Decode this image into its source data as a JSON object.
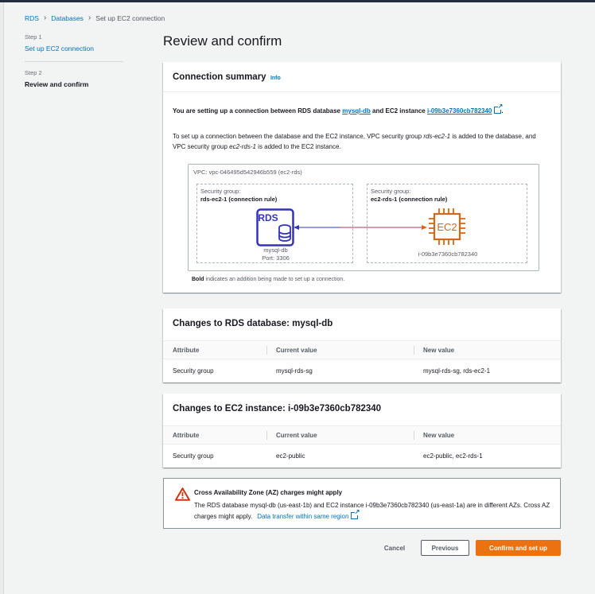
{
  "breadcrumb": {
    "items": [
      "RDS",
      "Databases"
    ],
    "current": "Set up EC2 connection"
  },
  "steps": [
    {
      "label": "Step 1",
      "title": "Set up EC2 connection"
    },
    {
      "label": "Step 2",
      "title": "Review and confirm"
    }
  ],
  "page_title": "Review and confirm",
  "summary": {
    "title": "Connection summary",
    "info": "Info",
    "line_prefix": "You are setting up a connection between RDS database",
    "db_link": "mysql-db",
    "line_middle": "and EC2 instance",
    "instance_link": "i-09b3e7360cb782340",
    "line_suffix": ".",
    "para_1": "To set up a connection between the database and the EC2 instance, VPC security group ",
    "para_sg1": "rds-ec2-1",
    "para_2": " is added to the database, and VPC security group ",
    "para_sg2": "ec2-rds-1",
    "para_3": " is added to the EC2 instance.",
    "vpc_label": "VPC: vpc-046495d542946b559 (ec2-rds)",
    "rds_sg_label": "Security group:",
    "rds_sg_name": "rds-ec2-1 (connection rule)",
    "rds_icon_text": "RDS",
    "rds_db_name": "mysql-db",
    "rds_port": "Port: 3306",
    "ec2_sg_label": "Security group:",
    "ec2_sg_name": "ec2-rds-1 (connection rule)",
    "ec2_icon_text": "EC2",
    "ec2_instance_name": "i-09b3e7360cb782340",
    "legend_bold": "Bold",
    "legend_text": " indicates an addition being made to set up a connection."
  },
  "rds_changes": {
    "title": "Changes to RDS database: mysql-db",
    "headers": [
      "Attribute",
      "Current value",
      "New value"
    ],
    "rows": [
      [
        "Security group",
        "mysql-rds-sg",
        "mysql-rds-sg, rds-ec2-1"
      ]
    ]
  },
  "ec2_changes": {
    "title": "Changes to EC2 instance: i-09b3e7360cb782340",
    "headers": [
      "Attribute",
      "Current value",
      "New value"
    ],
    "rows": [
      [
        "Security group",
        "ec2-public",
        "ec2-public, ec2-rds-1"
      ]
    ]
  },
  "warning": {
    "title": "Cross Availability Zone (AZ) charges might apply",
    "body": "The RDS database mysql-db (us-east-1b) and EC2 instance i-09b3e7360cb782340 (us-east-1a) are in different AZs. Cross AZ charges might apply.",
    "link": "Data transfer within same region"
  },
  "actions": {
    "cancel": "Cancel",
    "previous": "Previous",
    "confirm": "Confirm and set up"
  },
  "colors": {
    "link": "#0073bb",
    "primary_button": "#ec7211",
    "rds_icon": "#3334b9",
    "ec2_icon": "#d86613",
    "warning": "#d13212"
  }
}
